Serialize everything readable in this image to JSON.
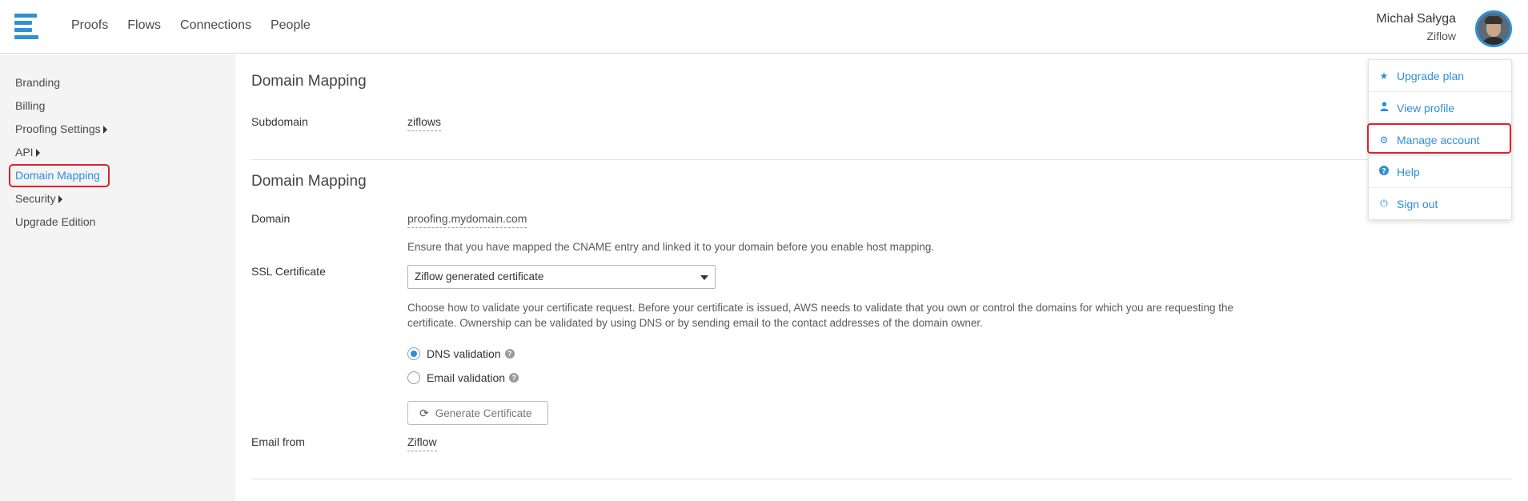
{
  "topbar": {
    "nav": [
      "Proofs",
      "Flows",
      "Connections",
      "People"
    ],
    "user_name": "Michał Sałyga",
    "org": "Ziflow",
    "brand_color": "#2f8fd8"
  },
  "sidebar": {
    "items": [
      {
        "label": "Branding"
      },
      {
        "label": "Billing"
      },
      {
        "label": "Proofing Settings"
      },
      {
        "label": "API"
      },
      {
        "label": "Domain Mapping"
      },
      {
        "label": "Security"
      },
      {
        "label": "Upgrade Edition"
      }
    ],
    "active": "Domain Mapping"
  },
  "main": {
    "section1_title": "Domain Mapping",
    "subdomain_label": "Subdomain",
    "subdomain_value": "ziflows",
    "section2_title": "Domain Mapping",
    "domain_label": "Domain",
    "domain_value": "proofing.mydomain.com",
    "domain_hint": "Ensure that you have mapped the CNAME entry and linked it to your domain before you enable host mapping.",
    "ssl_label": "SSL Certificate",
    "ssl_select": "Ziflow generated certificate",
    "ssl_hint_1": "Choose how to validate your certificate request. Before your certificate is issued, AWS needs to validate that you own or control the domains for which you are requesting the",
    "ssl_hint_2": "certificate. Ownership can be validated by using DNS or by sending email to the contact addresses of the domain owner.",
    "radio_dns": "DNS validation",
    "radio_email": "Email validation",
    "generate_button": "Generate Certificate",
    "email_from_label": "Email from",
    "email_from_value": "Ziflow"
  },
  "menu": {
    "items": [
      {
        "label": "Upgrade plan",
        "icon": "star-icon"
      },
      {
        "label": "View profile",
        "icon": "user-icon"
      },
      {
        "label": "Manage account",
        "icon": "gear-icon"
      },
      {
        "label": "Help",
        "icon": "question-circle-icon"
      },
      {
        "label": "Sign out",
        "icon": "power-icon"
      }
    ],
    "highlighted": "Manage account"
  }
}
